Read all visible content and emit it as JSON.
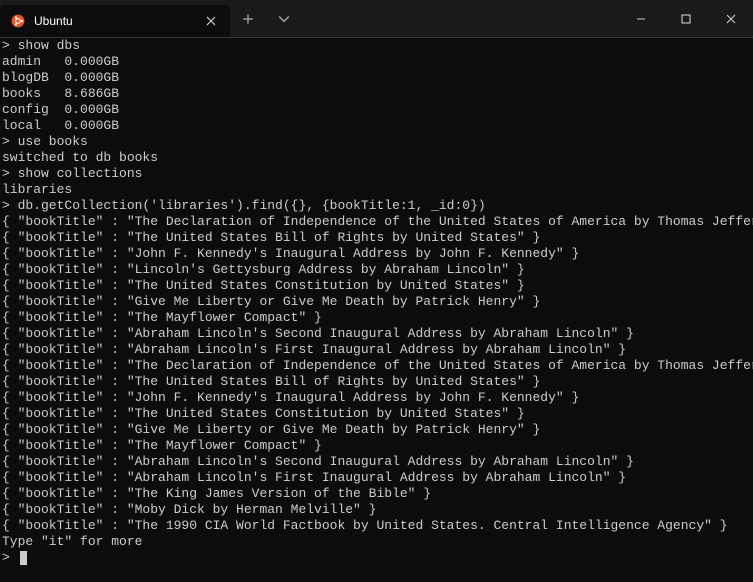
{
  "titlebar": {
    "tab_title": "Ubuntu"
  },
  "terminal": {
    "lines": [
      "> show dbs",
      "admin   0.000GB",
      "blogDB  0.000GB",
      "books   8.686GB",
      "config  0.000GB",
      "local   0.000GB",
      "> use books",
      "switched to db books",
      "> show collections",
      "libraries",
      "> db.getCollection('libraries').find({}, {bookTitle:1, _id:0})",
      "{ \"bookTitle\" : \"The Declaration of Independence of the United States of America by Thomas Jefferson\" }",
      "{ \"bookTitle\" : \"The United States Bill of Rights by United States\" }",
      "{ \"bookTitle\" : \"John F. Kennedy's Inaugural Address by John F. Kennedy\" }",
      "{ \"bookTitle\" : \"Lincoln's Gettysburg Address by Abraham Lincoln\" }",
      "{ \"bookTitle\" : \"The United States Constitution by United States\" }",
      "{ \"bookTitle\" : \"Give Me Liberty or Give Me Death by Patrick Henry\" }",
      "{ \"bookTitle\" : \"The Mayflower Compact\" }",
      "{ \"bookTitle\" : \"Abraham Lincoln's Second Inaugural Address by Abraham Lincoln\" }",
      "{ \"bookTitle\" : \"Abraham Lincoln's First Inaugural Address by Abraham Lincoln\" }",
      "{ \"bookTitle\" : \"The Declaration of Independence of the United States of America by Thomas Jefferson\" }",
      "{ \"bookTitle\" : \"The United States Bill of Rights by United States\" }",
      "{ \"bookTitle\" : \"John F. Kennedy's Inaugural Address by John F. Kennedy\" }",
      "{ \"bookTitle\" : \"The United States Constitution by United States\" }",
      "{ \"bookTitle\" : \"Give Me Liberty or Give Me Death by Patrick Henry\" }",
      "{ \"bookTitle\" : \"The Mayflower Compact\" }",
      "{ \"bookTitle\" : \"Abraham Lincoln's Second Inaugural Address by Abraham Lincoln\" }",
      "{ \"bookTitle\" : \"Abraham Lincoln's First Inaugural Address by Abraham Lincoln\" }",
      "{ \"bookTitle\" : \"The King James Version of the Bible\" }",
      "{ \"bookTitle\" : \"Moby Dick by Herman Melville\" }",
      "{ \"bookTitle\" : \"The 1990 CIA World Factbook by United States. Central Intelligence Agency\" }",
      "Type \"it\" for more"
    ],
    "prompt": "> "
  }
}
